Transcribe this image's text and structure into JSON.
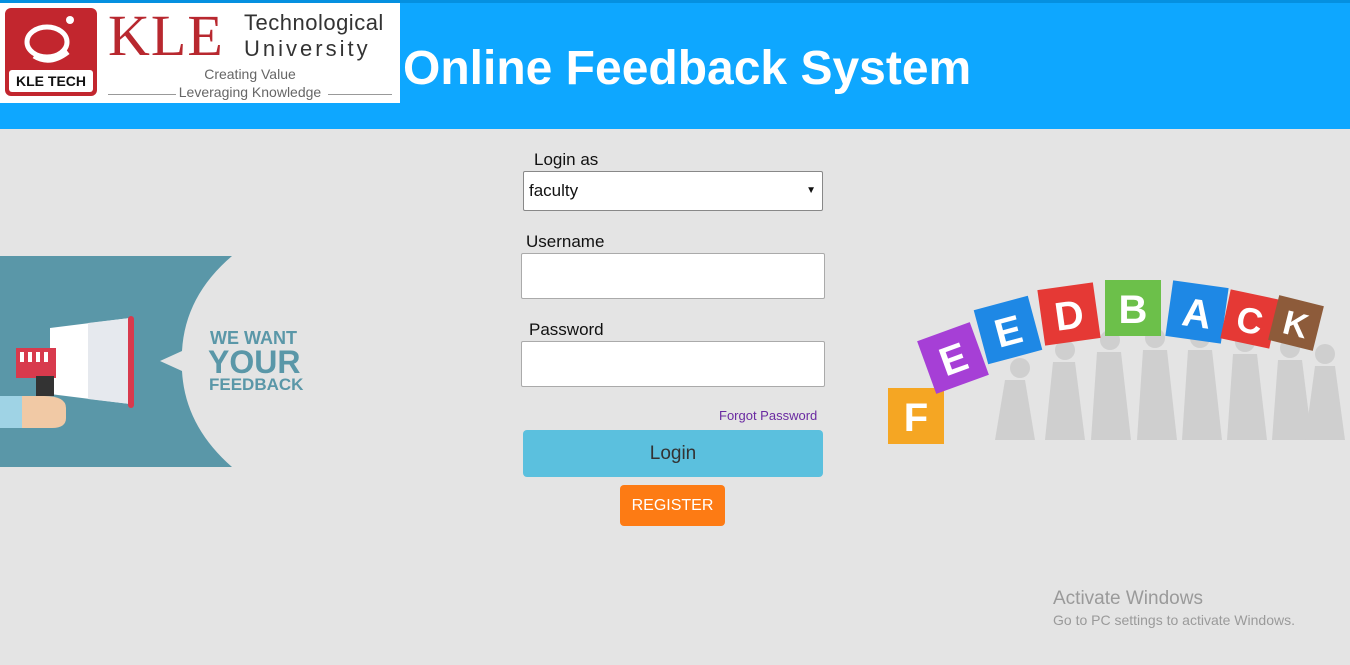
{
  "header": {
    "title": "Online Feedback System",
    "background": "#0ea7ff",
    "logo": {
      "badge_text": "KLE TECH",
      "name": "KLE",
      "line1": "Technological",
      "line2": "University",
      "tagline1": "Creating Value",
      "tagline2": "Leveraging Knowledge"
    }
  },
  "form": {
    "login_as_label": "Login as",
    "login_as_value": "faculty",
    "username_label": "Username",
    "username_value": "",
    "password_label": "Password",
    "password_value": "",
    "forgot_password": "Forgot Password",
    "login_button": "Login",
    "register_button": "REGISTER"
  },
  "illustrations": {
    "left_text_1": "WE WANT",
    "left_text_2": "YOUR",
    "left_text_3": "FEEDBACK",
    "right_letters": [
      "F",
      "E",
      "E",
      "D",
      "B",
      "A",
      "C",
      "K"
    ],
    "right_icon": "feedback-blocks-people-icon",
    "left_icon": "megaphone-icon"
  },
  "watermark": {
    "line1": "Activate Windows",
    "line2": "Go to PC settings to activate Windows."
  },
  "colors": {
    "login_button": "#5bc0de",
    "register_button": "#fd7b14",
    "page_background": "#e4e4e4"
  }
}
